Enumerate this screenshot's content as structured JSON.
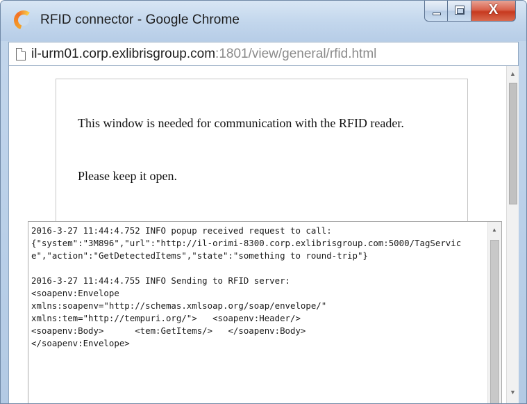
{
  "window": {
    "title": "RFID connector - Google Chrome",
    "close_glyph": "X"
  },
  "omnibox": {
    "host": "il-urm01.corp.exlibrisgroup.com",
    "path": ":1801/view/general/rfid.html"
  },
  "page": {
    "notice_line1": "This window is needed for communication with the RFID reader.",
    "notice_line2": "Please keep it open.",
    "log_text": "2016-3-27 11:44:4.752 INFO popup received request to call:\n{\"system\":\"3M896\",\"url\":\"http://il-orimi-8300.corp.exlibrisgroup.com:5000/TagService\",\"action\":\"GetDetectedItems\",\"state\":\"something to round-trip\"}\n\n2016-3-27 11:44:4.755 INFO Sending to RFID server:\n<soapenv:Envelope\nxmlns:soapenv=\"http://schemas.xmlsoap.org/soap/envelope/\"\nxmlns:tem=\"http://tempuri.org/\">   <soapenv:Header/>\n<soapenv:Body>      <tem:GetItems/>   </soapenv:Body>\n</soapenv:Envelope>"
  },
  "icons": {
    "chrome_logo": "chrome-icon",
    "page_icon": "page-icon",
    "up_arrow": "▲",
    "down_arrow": "▼"
  },
  "colors": {
    "titlebar": "#c2d6ec",
    "close_button": "#c7391f"
  }
}
